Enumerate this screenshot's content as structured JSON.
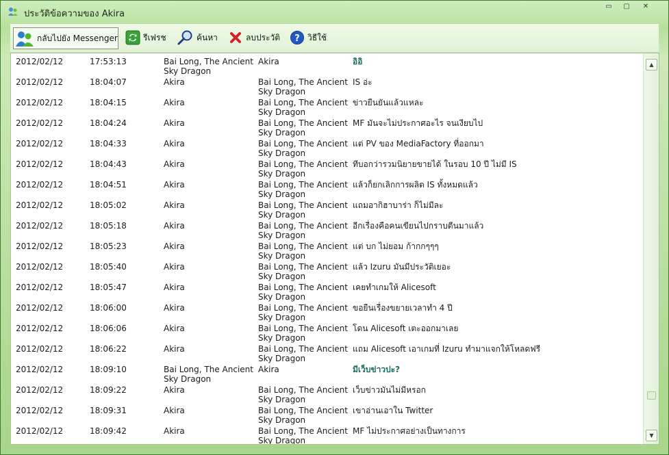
{
  "window": {
    "title": "ประวัติข้อความของ Akira",
    "minimize_label": "▭",
    "restore_label": "▢",
    "close_label": "✕"
  },
  "toolbar": {
    "back_label": "กลับไปยัง Messenger",
    "refresh_label": "รีเฟรช",
    "search_label": "ค้นหา",
    "delete_label": "ลบประวัติ",
    "help_label": "วิธีใช้"
  },
  "scrollbar": {
    "up_label": "▲",
    "down_label": "▼",
    "position_fraction": 0.92
  },
  "messages": [
    {
      "date": "2012/02/12",
      "time": "17:53:13",
      "from": "Bai Long, The Ancient Sky Dragon",
      "to": "Akira",
      "text": "อิอิ",
      "own": true
    },
    {
      "date": "2012/02/12",
      "time": "18:04:07",
      "from": "Akira",
      "to": "Bai Long, The Ancient Sky Dragon",
      "text": "IS อ่ะ",
      "own": false
    },
    {
      "date": "2012/02/12",
      "time": "18:04:15",
      "from": "Akira",
      "to": "Bai Long, The Ancient Sky Dragon",
      "text": "ข่าวยืนยันแล้วแหละ",
      "own": false
    },
    {
      "date": "2012/02/12",
      "time": "18:04:24",
      "from": "Akira",
      "to": "Bai Long, The Ancient Sky Dragon",
      "text": "MF มันจะไม่ประกาศอะไร จนเงียบไป",
      "own": false
    },
    {
      "date": "2012/02/12",
      "time": "18:04:33",
      "from": "Akira",
      "to": "Bai Long, The Ancient Sky Dragon",
      "text": "แต่ PV ของ MediaFactory ที่ออกมา",
      "own": false
    },
    {
      "date": "2012/02/12",
      "time": "18:04:43",
      "from": "Akira",
      "to": "Bai Long, The Ancient Sky Dragon",
      "text": "ทีบอกว่ารวมนิยายขายได้ ในรอบ 10 ปี ไม่มี IS",
      "own": false
    },
    {
      "date": "2012/02/12",
      "time": "18:04:51",
      "from": "Akira",
      "to": "Bai Long, The Ancient Sky Dragon",
      "text": "แล้วก็ยกเลิกการผลิต IS ทั้งหมดแล้ว",
      "own": false
    },
    {
      "date": "2012/02/12",
      "time": "18:05:02",
      "from": "Akira",
      "to": "Bai Long, The Ancient Sky Dragon",
      "text": "แถมอากิฮาบาร่า ก็ไม่มีละ",
      "own": false
    },
    {
      "date": "2012/02/12",
      "time": "18:05:18",
      "from": "Akira",
      "to": "Bai Long, The Ancient Sky Dragon",
      "text": "อีกเรื่องคือคนเขียนไปกราบตีนมาแล้ว",
      "own": false
    },
    {
      "date": "2012/02/12",
      "time": "18:05:23",
      "from": "Akira",
      "to": "Bai Long, The Ancient Sky Dragon",
      "text": "แต่ บก ไม่ยอม ก้ากกๆๆๆ",
      "own": false
    },
    {
      "date": "2012/02/12",
      "time": "18:05:40",
      "from": "Akira",
      "to": "Bai Long, The Ancient Sky Dragon",
      "text": "แล้ว Izuru มันมีประวัติเยอะ",
      "own": false
    },
    {
      "date": "2012/02/12",
      "time": "18:05:47",
      "from": "Akira",
      "to": "Bai Long, The Ancient Sky Dragon",
      "text": "เคยทำเกมให้ Alicesoft",
      "own": false
    },
    {
      "date": "2012/02/12",
      "time": "18:06:00",
      "from": "Akira",
      "to": "Bai Long, The Ancient Sky Dragon",
      "text": "ขอยืนเรื่องขยายเวลาทำ 4 ปี",
      "own": false
    },
    {
      "date": "2012/02/12",
      "time": "18:06:06",
      "from": "Akira",
      "to": "Bai Long, The Ancient Sky Dragon",
      "text": "โดน Alicesoft เตะออกมาเลย",
      "own": false
    },
    {
      "date": "2012/02/12",
      "time": "18:06:22",
      "from": "Akira",
      "to": "Bai Long, The Ancient Sky Dragon",
      "text": "แถม Alicesoft เอาเกมที่ Izuru ทำมาแจกให้โหลดฟรี",
      "own": false
    },
    {
      "date": "2012/02/12",
      "time": "18:09:10",
      "from": "Bai Long, The Ancient Sky Dragon",
      "to": "Akira",
      "text": "มีเว็บข่าวปะ?",
      "own": true
    },
    {
      "date": "2012/02/12",
      "time": "18:09:22",
      "from": "Akira",
      "to": "Bai Long, The Ancient Sky Dragon",
      "text": "เว็บข่าวมันไม่มีหรอก",
      "own": false
    },
    {
      "date": "2012/02/12",
      "time": "18:09:31",
      "from": "Akira",
      "to": "Bai Long, The Ancient Sky Dragon",
      "text": "เขาอ่านเอาใน Twitter",
      "own": false
    },
    {
      "date": "2012/02/12",
      "time": "18:09:42",
      "from": "Akira",
      "to": "Bai Long, The Ancient Sky Dragon",
      "text": "MF ไม่ประกาศอย่างเป็นทางการ",
      "own": false
    }
  ]
}
